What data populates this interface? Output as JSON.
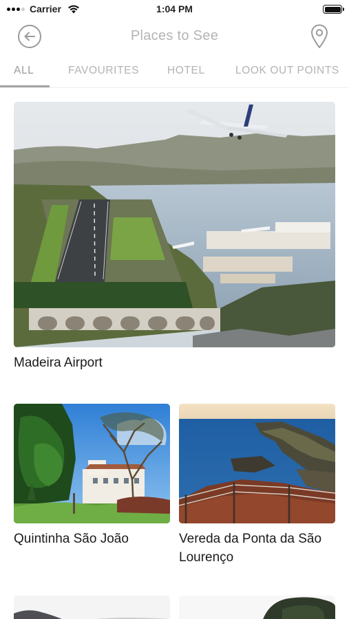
{
  "status_bar": {
    "carrier": "Carrier",
    "time": "1:04 PM",
    "icons": [
      "signal-icon",
      "wifi-icon",
      "battery-icon"
    ]
  },
  "header": {
    "title": "Places to See",
    "back_icon": "arrow-left-circle-icon",
    "map_icon": "map-pin-icon"
  },
  "tabs": [
    {
      "label": "ALL",
      "active": true
    },
    {
      "label": "FAVOURITES",
      "active": false
    },
    {
      "label": "HOTEL",
      "active": false
    },
    {
      "label": "LOOK OUT POINTS",
      "active": false
    }
  ],
  "places": [
    {
      "name": "Madeira Airport",
      "image": "airport-photo"
    },
    {
      "name": "Quintinha São João",
      "image": "garden-hotel-photo"
    },
    {
      "name": "Vereda da Ponta da São Lourenço",
      "image": "coastal-cliff-photo"
    }
  ],
  "colors": {
    "accent_gray": "#9a9a9a",
    "inactive_tab": "#b3b3b3",
    "text": "#1b1b1b",
    "background": "#ffffff"
  }
}
